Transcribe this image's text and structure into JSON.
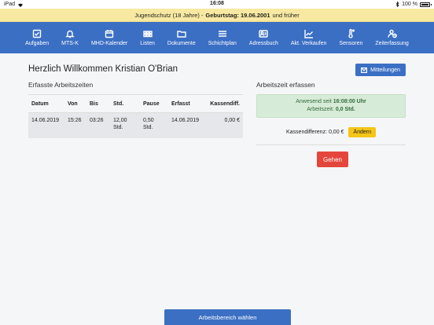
{
  "status_bar": {
    "device": "iPad",
    "time": "16:08",
    "battery": "100 %"
  },
  "banner": {
    "prefix": "Jugendschutz (18 Jahre) -",
    "bold": "Geburtstag: 19.06.2001",
    "suffix": "und früher"
  },
  "nav": [
    {
      "label": "Aufgaben",
      "icon": "checkbox-icon"
    },
    {
      "label": "MTS-K",
      "icon": "bell-icon"
    },
    {
      "label": "MHD-Kalender",
      "icon": "calendar-icon"
    },
    {
      "label": "Listen",
      "icon": "list-grid-icon"
    },
    {
      "label": "Dokumente",
      "icon": "folder-icon"
    },
    {
      "label": "Schichtplan",
      "icon": "lines-icon"
    },
    {
      "label": "Adressbuch",
      "icon": "contact-card-icon"
    },
    {
      "label": "Akt. Verkaufen",
      "icon": "chart-line-icon"
    },
    {
      "label": "Sensoren",
      "icon": "thermometer-icon"
    },
    {
      "label": "Zeiterfassung",
      "icon": "user-clock-icon"
    }
  ],
  "main": {
    "greeting": "Herzlich Willkommen Kristian O'Brian",
    "messages_button": "Mitteilungen",
    "left_title": "Erfasste Arbeitszeiten",
    "right_title": "Arbeitszeit erfassen",
    "table": {
      "headers": [
        "Datum",
        "Von",
        "Bis",
        "Std.",
        "Pause",
        "Erfasst",
        "Kassendiff."
      ],
      "rows": [
        [
          "14.06.2019",
          "15:26",
          "03:26",
          "12,00 Std.",
          "0,50 Std.",
          "14.06.2019",
          "0,00 €"
        ]
      ]
    },
    "present": {
      "line1_prefix": "Anwesend seit",
      "line1_time": "16:08:00 Uhr",
      "line2_prefix": "Arbeitszeit:",
      "line2_value": "0,0 Std."
    },
    "cash_diff": "Kassendifferenz: 0,00 €",
    "change_button": "Ändern",
    "go_button": "Gehen"
  },
  "bottom_button": "Arbeitsbereich wählen"
}
